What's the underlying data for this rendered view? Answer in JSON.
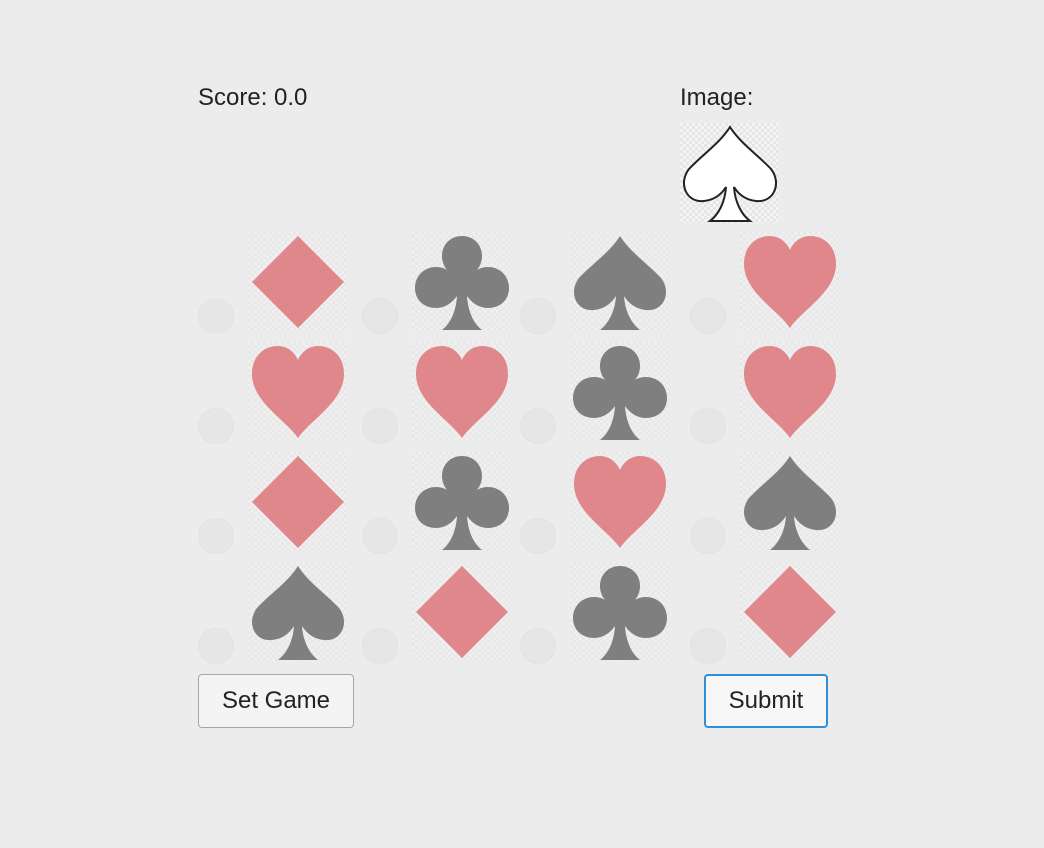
{
  "score_text": "Score: 0.0",
  "image_label": "Image:",
  "target_suit": "spade",
  "target_color": "#ffffff",
  "colors": {
    "red_suit": "#e0878b",
    "black_suit": "#7f7f7f",
    "target_outline": "#222222",
    "radio": "#e6e6e6",
    "submit_focus": "#2f8fd9"
  },
  "grid": {
    "rows": 4,
    "cols": 4,
    "cells": [
      [
        "diamond",
        "club",
        "spade",
        "heart"
      ],
      [
        "heart",
        "heart",
        "club",
        "heart"
      ],
      [
        "diamond",
        "club",
        "heart",
        "spade"
      ],
      [
        "spade",
        "diamond",
        "club",
        "diamond"
      ]
    ]
  },
  "buttons": {
    "set_game": "Set Game",
    "submit": "Submit"
  }
}
